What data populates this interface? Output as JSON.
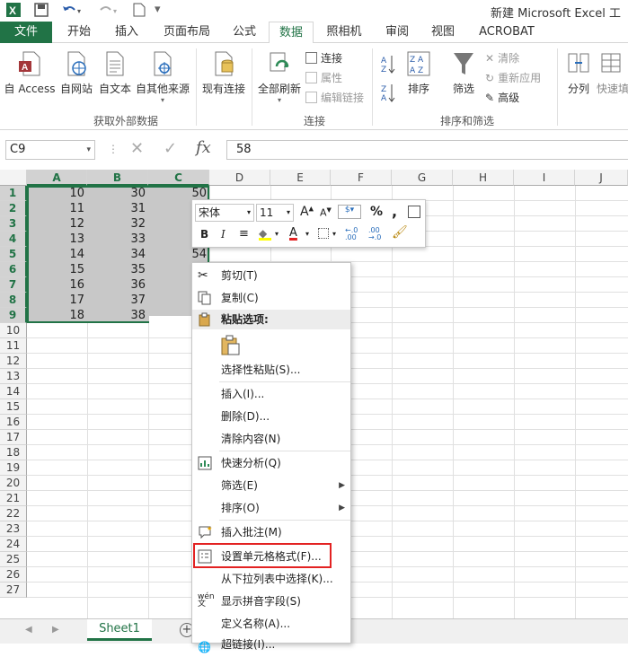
{
  "titlebar": {
    "title": "新建 Microsoft Excel 工"
  },
  "tabs": [
    "文件",
    "开始",
    "插入",
    "页面布局",
    "公式",
    "数据",
    "照相机",
    "审阅",
    "视图",
    "ACROBAT"
  ],
  "ribbon": {
    "get_external": {
      "access": "自 Access",
      "web": "自网站",
      "text": "自文本",
      "other": "自其他来源",
      "existing": "现有连接",
      "label": "获取外部数据"
    },
    "connections": {
      "refresh_all": "全部刷新",
      "connections": "连接",
      "properties": "属性",
      "edit_links": "编辑链接",
      "label": "连接"
    },
    "sort_filter": {
      "sort": "排序",
      "filter": "筛选",
      "clear": "清除",
      "reapply": "重新应用",
      "advanced": "高级",
      "label": "排序和筛选"
    },
    "data_tools": {
      "text_to_cols": "分列",
      "flash_fill": "快速填"
    }
  },
  "formula_bar": {
    "name_box": "C9",
    "formula": "58"
  },
  "columns": [
    "A",
    "B",
    "C",
    "D",
    "E",
    "F",
    "G",
    "H",
    "I",
    "J"
  ],
  "rows": [
    "1",
    "2",
    "3",
    "4",
    "5",
    "6",
    "7",
    "8",
    "9",
    "10",
    "11",
    "12",
    "13",
    "14",
    "15",
    "16",
    "17",
    "18",
    "19",
    "20",
    "21",
    "22",
    "23",
    "24",
    "25",
    "26",
    "27"
  ],
  "cells": {
    "A": [
      "10",
      "11",
      "12",
      "13",
      "14",
      "15",
      "16",
      "17",
      "18"
    ],
    "B": [
      "30",
      "31",
      "32",
      "33",
      "34",
      "35",
      "36",
      "37",
      "38"
    ],
    "C1": "50",
    "C5": "54"
  },
  "minibar": {
    "font": "宋体",
    "size": "11",
    "bold": "B",
    "italic": "I",
    "percent": "%",
    "comma": ","
  },
  "context_menu": {
    "cut": "剪切(T)",
    "copy": "复制(C)",
    "paste_options": "粘贴选项:",
    "paste_special": "选择性粘贴(S)...",
    "insert": "插入(I)...",
    "delete": "删除(D)...",
    "clear": "清除内容(N)",
    "quick_analysis": "快速分析(Q)",
    "filter": "筛选(E)",
    "sort": "排序(O)",
    "insert_comment": "插入批注(M)",
    "format_cells": "设置单元格格式(F)...",
    "pick_list": "从下拉列表中选择(K)...",
    "phonetic": "显示拼音字段(S)",
    "define_name": "定义名称(A)...",
    "hyperlink": "超链接(I)..."
  },
  "sheet": {
    "name": "Sheet1"
  },
  "colors": {
    "accent": "#217346",
    "highlight": "#e32222"
  }
}
